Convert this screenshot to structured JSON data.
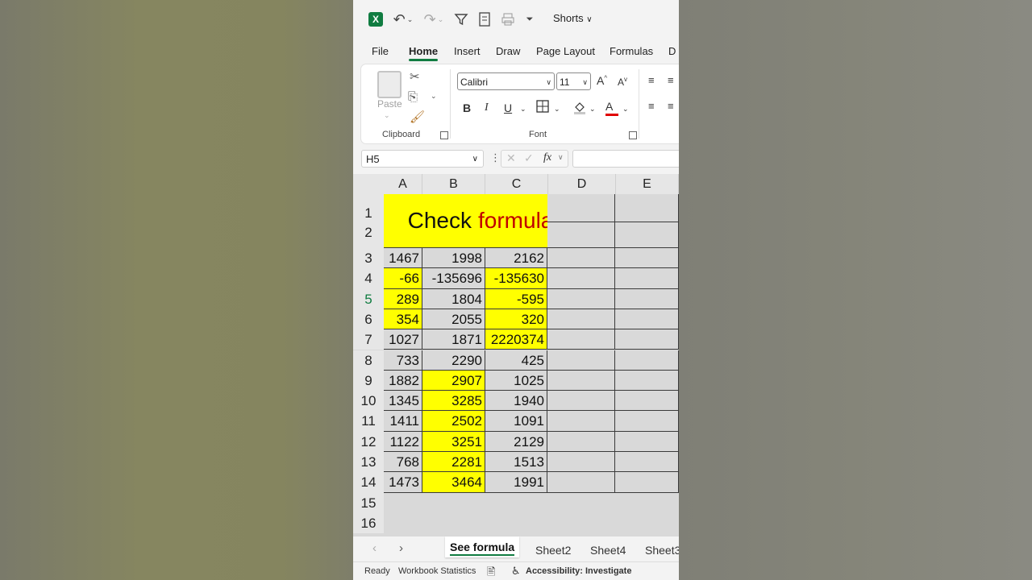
{
  "quick_access": {
    "file_name": "Shorts",
    "icons": [
      "excel-logo-icon",
      "undo-icon",
      "redo-icon",
      "filter-icon",
      "form-icon",
      "print-icon",
      "customize-icon"
    ],
    "excel_letter": "X"
  },
  "ribbon_tabs": [
    "File",
    "Home",
    "Insert",
    "Draw",
    "Page Layout",
    "Formulas",
    "D"
  ],
  "active_tab": "Home",
  "clipboard": {
    "paste_label": "Paste",
    "group_label": "Clipboard"
  },
  "font": {
    "group_label": "Font",
    "font_name": "Calibri",
    "font_size": "11",
    "bold": "B",
    "italic": "I",
    "underline": "U",
    "grow": "A",
    "shrink": "A",
    "font_color": "A",
    "font_color_bar": "#e00000"
  },
  "formula_bar": {
    "name_box": "H5",
    "fx": "fx",
    "value": ""
  },
  "columns": [
    "A",
    "B",
    "C",
    "D",
    "E"
  ],
  "rows": [
    "1",
    "2",
    "3",
    "4",
    "5",
    "6",
    "7",
    "8",
    "9",
    "10",
    "11",
    "12",
    "13",
    "14",
    "15",
    "16"
  ],
  "selected_row": "5",
  "title": {
    "part1": "Check",
    "part2": "formula",
    "part2_color": "#c00000",
    "fill": "#ffff00"
  },
  "table": [
    {
      "row": "3",
      "a": "1467",
      "b": "1998",
      "c": "2162",
      "ay": false,
      "by": false,
      "cy": false
    },
    {
      "row": "4",
      "a": "-66",
      "b": "-135696",
      "c": "-135630",
      "ay": true,
      "by": false,
      "cy": true
    },
    {
      "row": "5",
      "a": "289",
      "b": "1804",
      "c": "-595",
      "ay": true,
      "by": false,
      "cy": true
    },
    {
      "row": "6",
      "a": "354",
      "b": "2055",
      "c": "320",
      "ay": true,
      "by": false,
      "cy": true
    },
    {
      "row": "7",
      "a": "1027",
      "b": "1871",
      "c": "2220374",
      "ay": false,
      "by": false,
      "cy": true
    },
    {
      "row": "8",
      "a": "733",
      "b": "2290",
      "c": "425",
      "ay": false,
      "by": false,
      "cy": false
    },
    {
      "row": "9",
      "a": "1882",
      "b": "2907",
      "c": "1025",
      "ay": false,
      "by": true,
      "cy": false
    },
    {
      "row": "10",
      "a": "1345",
      "b": "3285",
      "c": "1940",
      "ay": false,
      "by": true,
      "cy": false
    },
    {
      "row": "11",
      "a": "1411",
      "b": "2502",
      "c": "1091",
      "ay": false,
      "by": true,
      "cy": false
    },
    {
      "row": "12",
      "a": "1122",
      "b": "3251",
      "c": "2129",
      "ay": false,
      "by": true,
      "cy": false
    },
    {
      "row": "13",
      "a": "768",
      "b": "2281",
      "c": "1513",
      "ay": false,
      "by": true,
      "cy": false
    },
    {
      "row": "14",
      "a": "1473",
      "b": "3464",
      "c": "1991",
      "ay": false,
      "by": true,
      "cy": false
    }
  ],
  "sheet_tabs": [
    "See formula",
    "Sheet2",
    "Sheet4",
    "Sheet3"
  ],
  "active_sheet": "See formula",
  "status_bar": {
    "ready": "Ready",
    "stats": "Workbook Statistics",
    "accessibility": "Accessibility: Investigate"
  },
  "colors": {
    "accent": "#107c41",
    "highlight": "#ffff00",
    "grid_fill": "#d9d9d9"
  }
}
